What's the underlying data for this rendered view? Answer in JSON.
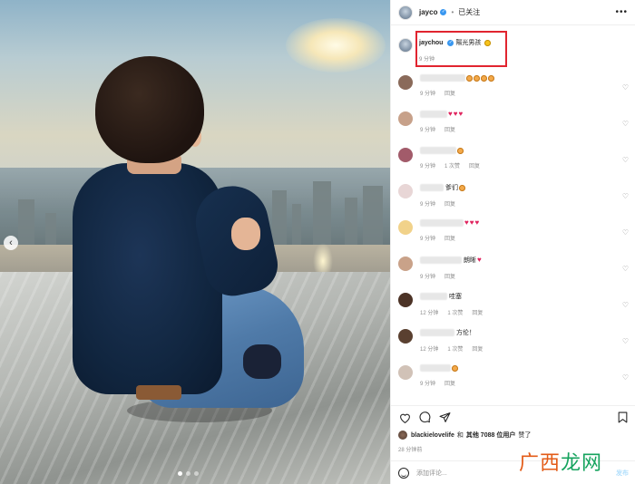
{
  "post": {
    "account": "jayco",
    "follow_sep": "•",
    "follow_label": "已关注",
    "more_label": "•••",
    "caption_user": "jaychou",
    "caption_text": "陽光男孩",
    "caption_time": "9 分钟"
  },
  "comments": [
    {
      "text": "",
      "emoji": [
        "face",
        "face",
        "face",
        "face"
      ],
      "time": "9 分钟",
      "reply": "回复",
      "likes": "",
      "avatar": "#8a6a5a"
    },
    {
      "text": "",
      "emoji": [
        "heart",
        "heart",
        "heart"
      ],
      "time": "9 分钟",
      "reply": "回复",
      "likes": "",
      "avatar": "#c7a18a"
    },
    {
      "text": "",
      "emoji": [
        "face"
      ],
      "time": "9 分钟",
      "reply": "回复",
      "likes": "1 次赞",
      "avatar": "#a25b6a"
    },
    {
      "text": "爹们",
      "emoji": [
        "face"
      ],
      "time": "9 分钟",
      "reply": "回复",
      "likes": "",
      "avatar": "#e8d6d6"
    },
    {
      "text": "",
      "emoji": [
        "heart",
        "heart",
        "heart"
      ],
      "time": "9 分钟",
      "reply": "回复",
      "likes": "",
      "avatar": "#f1d28a"
    },
    {
      "text": "朗晰",
      "emoji": [
        "heart"
      ],
      "time": "9 分钟",
      "reply": "回复",
      "likes": "",
      "avatar": "#c9a289"
    },
    {
      "text": "哇塞",
      "emoji": [],
      "time": "12 分钟",
      "reply": "回复",
      "likes": "1 次赞",
      "avatar": "#4c3326"
    },
    {
      "text": "方伦！",
      "emoji": [],
      "time": "12 分钟",
      "reply": "回复",
      "likes": "1 次赞",
      "avatar": "#5a4030"
    },
    {
      "text": "",
      "emoji": [
        "face"
      ],
      "time": "9 分钟",
      "reply": "回复",
      "likes": "",
      "avatar": "#d1c2b7"
    }
  ],
  "actions": {
    "like_icon": "heart-outline-icon",
    "comment_icon": "comment-bubble-icon",
    "share_icon": "paper-plane-icon",
    "save_icon": "bookmark-icon"
  },
  "likes": {
    "user": "blackielovelife",
    "and": "和",
    "others": "其他 7088 位用户",
    "suffix": "赞了"
  },
  "posted": "28 分钟前",
  "add_comment": {
    "placeholder": "添加评论...",
    "post_label": "发布"
  },
  "watermark": {
    "part1": "广西",
    "part2": "龙网"
  },
  "colors": {
    "highlight": "#e1242f",
    "verified": "#3897f0",
    "heart": "#e0245e",
    "watermark_orange": "#e35b17",
    "watermark_green": "#16a35e"
  }
}
